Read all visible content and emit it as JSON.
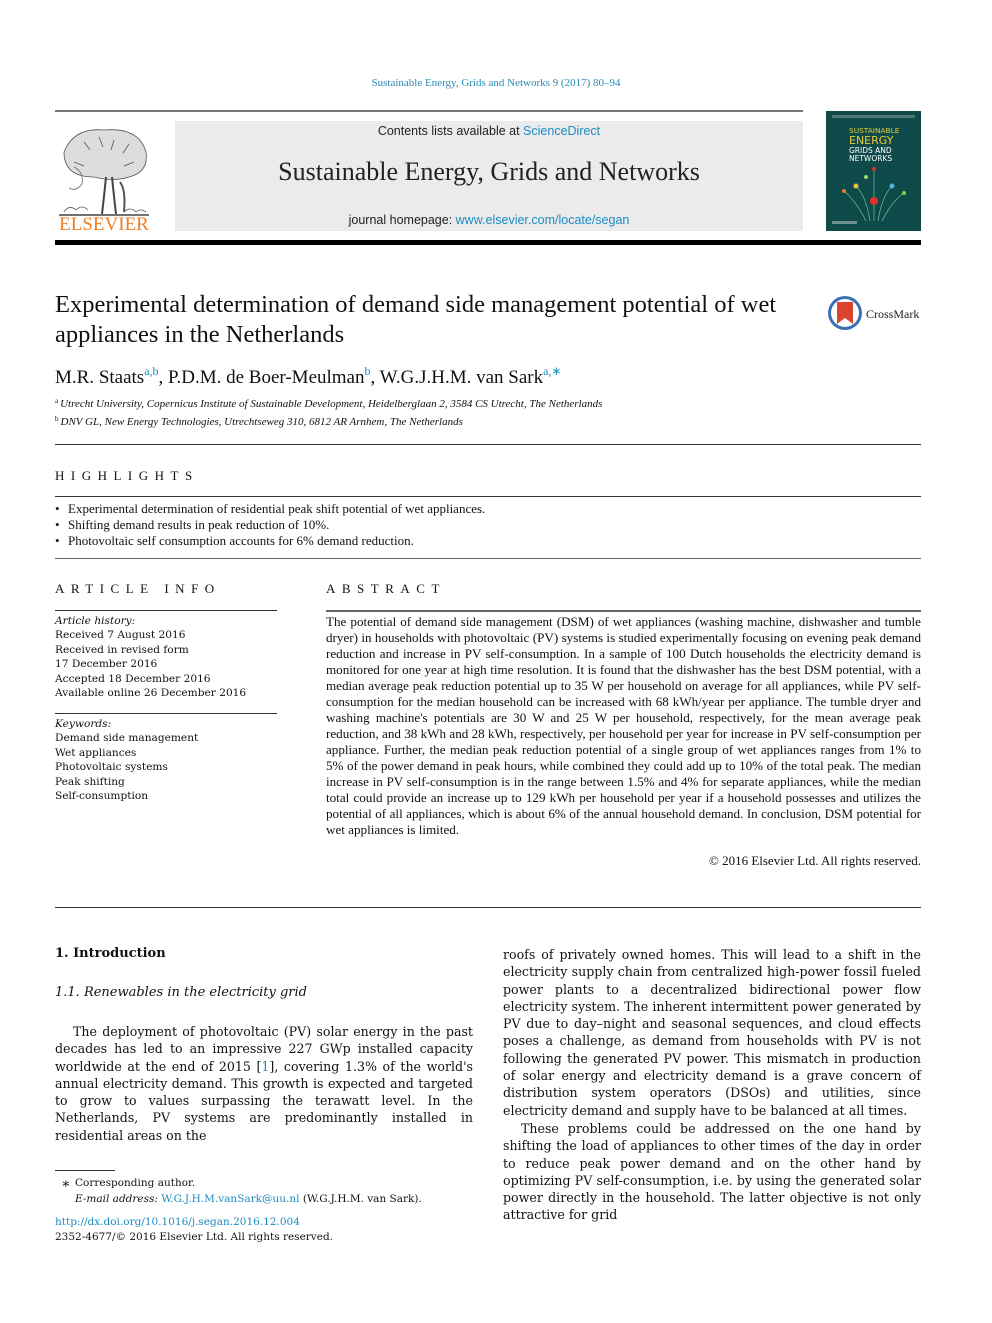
{
  "journal_citation": "Sustainable Energy, Grids and Networks 9 (2017) 80–94",
  "header": {
    "contents_prefix": "Contents lists available at ",
    "contents_link": "ScienceDirect",
    "journal_title": "Sustainable Energy, Grids and Networks",
    "homepage_prefix": "journal homepage: ",
    "homepage_link": "www.elsevier.com/locate/segan",
    "publisher_logo_text": "ELSEVIER",
    "cover": {
      "line1": "SUSTAINABLE",
      "line2": "ENERGY",
      "line3": "GRIDS AND",
      "line4": "NETWORKS"
    }
  },
  "colors": {
    "link": "#1a8cc4",
    "elsevier_orange": "#f07e22",
    "cover_bg": "#0f4a4a"
  },
  "article": {
    "title": "Experimental determination of demand side management potential of wet appliances in the Netherlands",
    "crossmark_label": "CrossMark",
    "authors": [
      {
        "name": "M.R. Staats",
        "sup": "a,b",
        "sep": ", "
      },
      {
        "name": "P.D.M. de Boer-Meulman",
        "sup": "b",
        "sep": ", "
      },
      {
        "name": "W.G.J.H.M. van Sark",
        "sup": "a,∗",
        "sep": ""
      }
    ],
    "affiliations": [
      {
        "key": "a",
        "text": "Utrecht University, Copernicus Institute of Sustainable Development, Heidelberglaan 2, 3584 CS Utrecht, The Netherlands"
      },
      {
        "key": "b",
        "text": "DNV GL, New Energy Technologies, Utrechtseweg 310, 6812 AR Arnhem, The Netherlands"
      }
    ]
  },
  "highlights": {
    "label": "HIGHLIGHTS",
    "items": [
      "Experimental determination of residential peak shift potential of wet appliances.",
      "Shifting demand results in peak reduction of 10%.",
      "Photovoltaic self consumption accounts for 6% demand reduction."
    ]
  },
  "article_info": {
    "label": "ARTICLE INFO",
    "history_heading": "Article history:",
    "history": [
      "Received 7 August 2016",
      "Received in revised form",
      "17 December 2016",
      "Accepted 18 December 2016",
      "Available online 26 December 2016"
    ],
    "keywords_heading": "Keywords:",
    "keywords": [
      "Demand side management",
      "Wet appliances",
      "Photovoltaic systems",
      "Peak shifting",
      "Self-consumption"
    ]
  },
  "abstract": {
    "label": "ABSTRACT",
    "text": "The potential of demand side management (DSM) of wet appliances (washing machine, dishwasher and tumble dryer) in households with photovoltaic (PV) systems is studied experimentally focusing on evening peak demand reduction and increase in PV self-consumption. In a sample of 100 Dutch households the electricity demand is monitored for one year at high time resolution. It is found that the dishwasher has the best DSM potential, with a median average peak reduction potential up to 35 W per household on average for all appliances, while PV self-consumption for the median household can be increased with 68 kWh/year per appliance. The tumble dryer and washing machine's potentials are 30 W and 25 W per household, respectively, for the mean average peak reduction, and 38 kWh and 28 kWh, respectively, per household per year for increase in PV self-consumption per appliance. Further, the median peak reduction potential of a single group of wet appliances ranges from 1% to 5% of the power demand in peak hours, while combined they could add up to 10% of the total peak. The median increase in PV self-consumption is in the range between 1.5% and 4% for separate appliances, while the median total could provide an increase up to 129 kWh per household per year if a household possesses and utilizes the potential of all appliances, which is about 6% of the annual household demand. In conclusion, DSM potential for wet appliances is limited.",
    "copyright": "© 2016 Elsevier Ltd. All rights reserved."
  },
  "body": {
    "section_heading": "1.  Introduction",
    "subsection_heading": "1.1.  Renewables in the electricity grid",
    "left_para_before_ref": "The deployment of photovoltaic (PV) solar energy in the past decades has led to an impressive 227 GWp installed capacity worldwide at the end of 2015 [",
    "left_para_ref": "1",
    "left_para_after_ref": "], covering 1.3% of the world's annual electricity demand. This growth is expected and targeted to grow to values surpassing the terawatt level. In the Netherlands, PV systems are predominantly installed in residential areas on the",
    "right_para1": "roofs of privately owned homes. This will lead to a shift in the electricity supply chain from centralized high-power fossil fueled power plants to a decentralized bidirectional power flow electricity system. The inherent intermittent power generated by PV due to day–night and seasonal sequences, and cloud effects poses a challenge, as demand from households with PV is not following the generated PV power. This mismatch in production of solar energy and electricity demand is a grave concern of distribution system operators (DSOs) and utilities, since electricity demand and supply have to be balanced at all times.",
    "right_para2": "These problems could be addressed on the one hand by shifting the load of appliances to other times of the day in order to reduce peak power demand and on the other hand by optimizing PV self-consumption, i.e. by using the generated solar power directly in the household. The latter objective is not only attractive for grid"
  },
  "footnote": {
    "star": "∗",
    "corresponding": "Corresponding author.",
    "email_label": "E-mail address: ",
    "email": "W.G.J.H.M.vanSark@uu.nl",
    "email_suffix": " (W.G.J.H.M. van Sark).",
    "doi": "http://dx.doi.org/10.1016/j.segan.2016.12.004",
    "issn_copyright": "2352-4677/© 2016 Elsevier Ltd. All rights reserved."
  }
}
